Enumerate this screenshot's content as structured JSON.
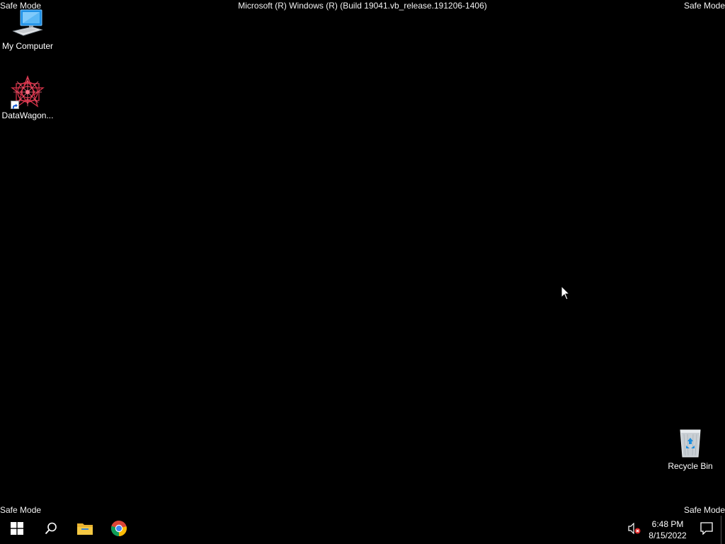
{
  "safe_mode": {
    "top_left": "Safe Mode",
    "top_right": "Safe Mode",
    "bottom_left": "Safe Mode",
    "bottom_right": "Safe Mode"
  },
  "build_info": "Microsoft (R) Windows (R) (Build 19041.vb_release.191206-1406)",
  "desktop_icons": {
    "my_computer": {
      "label": "My Computer",
      "icon": "computer-icon"
    },
    "datawagon": {
      "label": "DataWagon...",
      "icon": "datawagon-app-icon"
    },
    "recycle_bin": {
      "label": "Recycle Bin",
      "icon": "recycle-bin-icon"
    }
  },
  "taskbar": {
    "start": "windows-start-icon",
    "search": "search-icon",
    "file_explorer": "folder-icon",
    "chrome": "chrome-icon",
    "volume": "volume-muted-icon",
    "notifications": "action-center-icon"
  },
  "clock": {
    "time": "6:48 PM",
    "date": "8/15/2022"
  },
  "colors": {
    "background": "#000000",
    "text": "#ffffff"
  }
}
